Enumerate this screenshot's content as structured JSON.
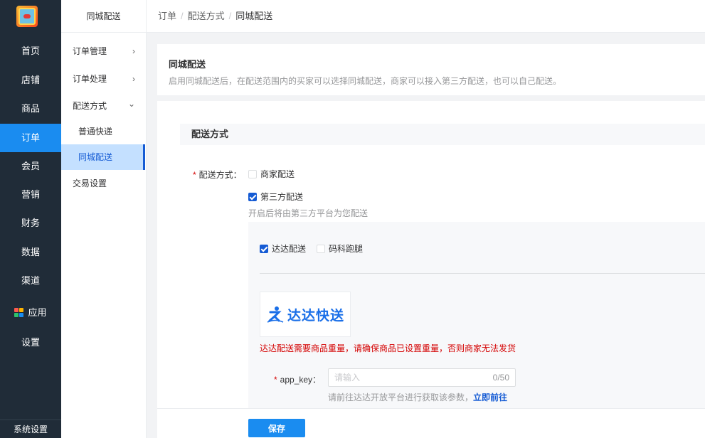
{
  "nav1": {
    "items": [
      "首页",
      "店铺",
      "商品",
      "订单",
      "会员",
      "营销",
      "财务",
      "数据",
      "渠道",
      "应用",
      "设置"
    ],
    "active": "订单",
    "footer": "系统设置"
  },
  "nav2": {
    "title": "同城配送",
    "items": {
      "order_mgmt": "订单管理",
      "order_proc": "订单处理",
      "delivery": "配送方式",
      "express": "普通快递",
      "city": "同城配送",
      "trade": "交易设置"
    },
    "arrows": {
      "right": "›",
      "down": "⌄"
    }
  },
  "breadcrumb": {
    "a": "订单",
    "b": "配送方式",
    "c": "同城配送",
    "sep": "/"
  },
  "intro": {
    "title": "同城配送",
    "desc": "启用同城配送后，在配送范围内的买家可以选择同城配送，商家可以接入第三方配送，也可以自己配送。"
  },
  "form": {
    "section_title": "配送方式",
    "method_label": "配送方式：",
    "opt_merchant": "商家配送",
    "opt_merchant_checked": false,
    "opt_third": "第三方配送",
    "opt_third_checked": true,
    "third_hint": "开启后将由第三方平台为您配送",
    "providers": [
      {
        "label": "达达配送",
        "checked": true
      },
      {
        "label": "码科跑腿",
        "checked": false
      }
    ],
    "dada_logo_text": "达达快送",
    "warning": "达达配送需要商品重量，请确保商品已设置重量，否则商家无法发货",
    "app_key_label": "app_key：",
    "app_key_placeholder": "请输入",
    "app_key_value": "",
    "app_key_count": "0/50",
    "app_key_hint": "请前往达达开放平台进行获取该参数，",
    "app_key_link": "立即前往"
  },
  "footer": {
    "save": "保存"
  },
  "colors": {
    "primary": "#155bd4",
    "nav_active": "#1a8cf0",
    "sidebar": "#202c38",
    "danger": "#d40000"
  }
}
